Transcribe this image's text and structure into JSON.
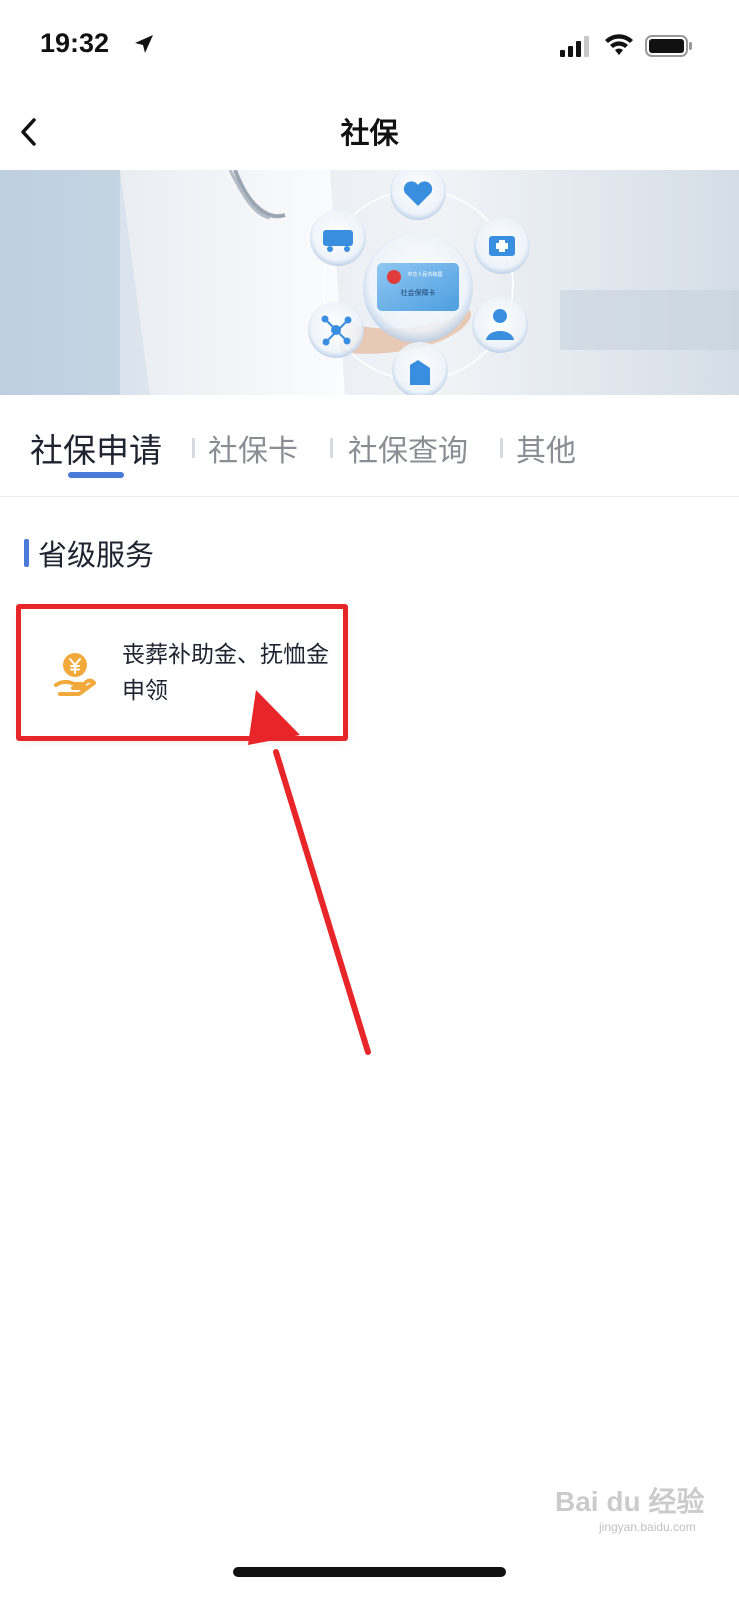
{
  "status_bar": {
    "time": "19:32",
    "icons": [
      "location-arrow-icon",
      "signal-icon",
      "wifi-icon",
      "battery-icon"
    ]
  },
  "nav": {
    "title": "社保",
    "back_icon": "chevron-left-icon"
  },
  "banner": {
    "card_title": "中华人民共和国",
    "card_subtitle": "社会保障卡",
    "icons": [
      "heart-icon",
      "ambulance-icon",
      "medical-kit-icon",
      "molecule-icon",
      "doctor-icon",
      "hand-icon"
    ]
  },
  "tabs": [
    {
      "label": "社保申请",
      "active": true
    },
    {
      "label": "社保卡",
      "active": false
    },
    {
      "label": "社保查询",
      "active": false
    },
    {
      "label": "其他",
      "active": false
    }
  ],
  "section": {
    "title": "省级服务"
  },
  "services": [
    {
      "label": "丧葬补助金、抚恤金申领",
      "icon": "yen-hand-icon"
    }
  ],
  "watermark": {
    "text": "Bai du 经验",
    "sub": "jingyan.baidu.com"
  },
  "colors": {
    "accent": "#4a7bd9",
    "highlight": "#e8262a",
    "service_icon": "#f2a93b"
  }
}
